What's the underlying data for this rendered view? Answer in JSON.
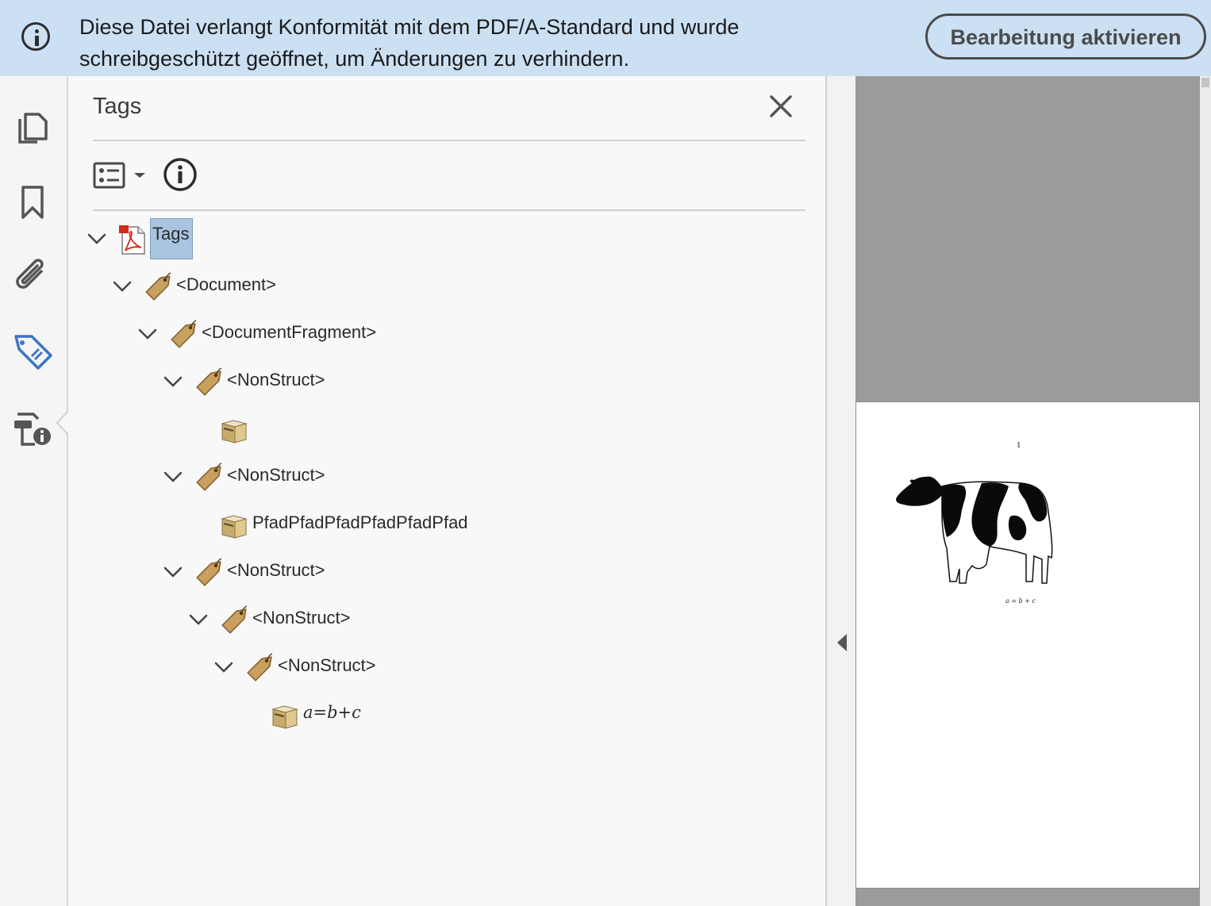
{
  "banner": {
    "message": "Diese Datei verlangt Konformität mit dem PDF/A-Standard und wurde schreibgeschützt geöffnet, um Änderungen zu verhindern.",
    "button_label": "Bearbeitung aktivieren"
  },
  "rail": {
    "items": [
      {
        "icon": "pages-icon",
        "active": false
      },
      {
        "icon": "bookmark-icon",
        "active": false
      },
      {
        "icon": "attachment-icon",
        "active": false
      },
      {
        "icon": "tags-icon",
        "active": true
      },
      {
        "icon": "document-properties-icon",
        "active": false
      }
    ],
    "active_color": "#3b74c4"
  },
  "panel": {
    "title": "Tags"
  },
  "tree": [
    {
      "label": "Tags",
      "level": 0,
      "type": "root",
      "expanded": true,
      "selected": true
    },
    {
      "label": "<Document>",
      "level": 1,
      "type": "tag",
      "expanded": true
    },
    {
      "label": "<DocumentFragment>",
      "level": 2,
      "type": "tag",
      "expanded": true
    },
    {
      "label": "<NonStruct>",
      "level": 3,
      "type": "tag",
      "expanded": true
    },
    {
      "label": "",
      "level": 4,
      "type": "content"
    },
    {
      "label": "<NonStruct>",
      "level": 3,
      "type": "tag",
      "expanded": true
    },
    {
      "label": "PfadPfadPfadPfadPfadPfad",
      "level": 4,
      "type": "content"
    },
    {
      "label": "<NonStruct>",
      "level": 3,
      "type": "tag",
      "expanded": true
    },
    {
      "label": "<NonStruct>",
      "level": 4,
      "type": "tag",
      "expanded": true
    },
    {
      "label": "<NonStruct>",
      "level": 5,
      "type": "tag",
      "expanded": true
    },
    {
      "label": "a=b+c",
      "level": 6,
      "type": "content",
      "math": true
    }
  ],
  "document": {
    "page_number": "1",
    "formula": "a = b + c"
  }
}
